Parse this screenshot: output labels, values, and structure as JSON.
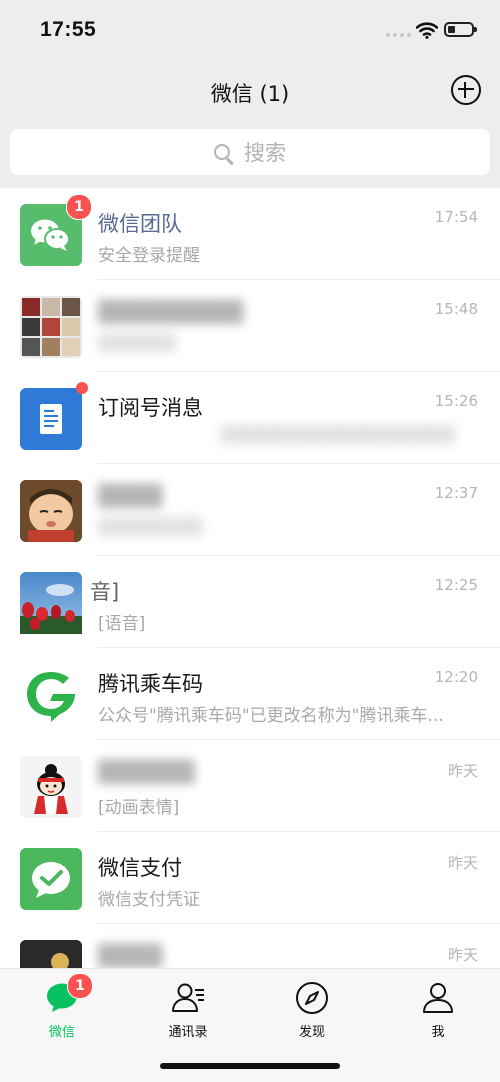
{
  "status": {
    "time": "17:55"
  },
  "header": {
    "title": "微信 (1)"
  },
  "search": {
    "placeholder": "搜索"
  },
  "chats": [
    {
      "name": "微信团队",
      "preview": "安全登录提醒",
      "time": "17:54",
      "badge": "1",
      "avatar_icon": "wechat-logo-icon"
    },
    {
      "name": "▒▒▒▒▒▒▒▒▒",
      "preview": "▒▒▒▒▒▒",
      "time": "15:48",
      "avatar_icon": "group-avatar-grid"
    },
    {
      "name": "订阅号消息",
      "preview": "▒▒▒▒▒▒▒▒▒▒▒▒▒▒▒▒▒▒",
      "time": "15:26",
      "avatar_icon": "subscription-doc-icon"
    },
    {
      "name": "▒▒▒▒",
      "preview": "▒▒▒▒▒▒▒▒",
      "time": "12:37",
      "avatar_icon": "cartoon-face-avatar"
    },
    {
      "name": "音]",
      "preview": "[语音]",
      "time": "12:25",
      "avatar_icon": "tulip-photo-avatar"
    },
    {
      "name": "腾讯乘车码",
      "preview": "公众号\"腾讯乘车码\"已更改名称为\"腾讯乘车...",
      "time": "12:20",
      "avatar_icon": "tencent-ride-code-icon"
    },
    {
      "name": "▒▒▒▒▒▒",
      "preview": "[动画表情]",
      "time": "昨天",
      "avatar_icon": "doll-avatar"
    },
    {
      "name": "微信支付",
      "preview": "微信支付凭证",
      "time": "昨天",
      "avatar_icon": "wechat-pay-icon"
    },
    {
      "name": "▒▒▒▒",
      "preview": "",
      "time": "昨天",
      "avatar_icon": "photo-avatar"
    }
  ],
  "tabs": [
    {
      "label": "微信",
      "badge": "1",
      "icon": "chat-bubble-icon",
      "active": true
    },
    {
      "label": "通讯录",
      "icon": "contacts-icon"
    },
    {
      "label": "发现",
      "icon": "compass-icon"
    },
    {
      "label": "我",
      "icon": "person-icon"
    }
  ],
  "colors": {
    "accent": "#07c160",
    "badge": "#fa5151",
    "background": "#ededed"
  }
}
